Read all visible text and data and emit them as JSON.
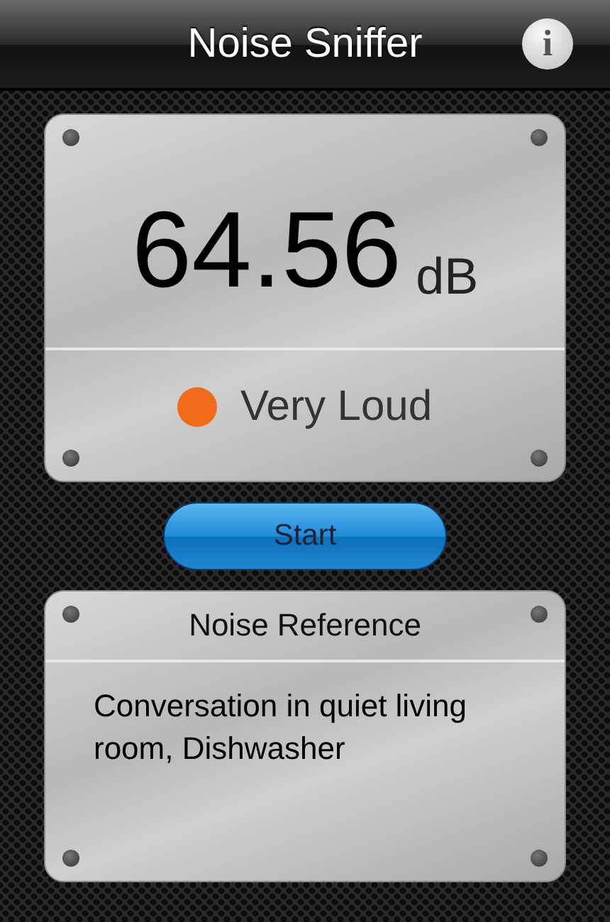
{
  "title_bar": {
    "title": "Noise Sniffer",
    "info_button": "i"
  },
  "meter": {
    "reading": "64.56",
    "unit": "dB",
    "status": {
      "label": "Very Loud",
      "color": "#f26a1b"
    }
  },
  "start_button": {
    "label": "Start"
  },
  "reference": {
    "heading": "Noise Reference",
    "text": "Conversation in quiet living room, Dishwasher"
  }
}
